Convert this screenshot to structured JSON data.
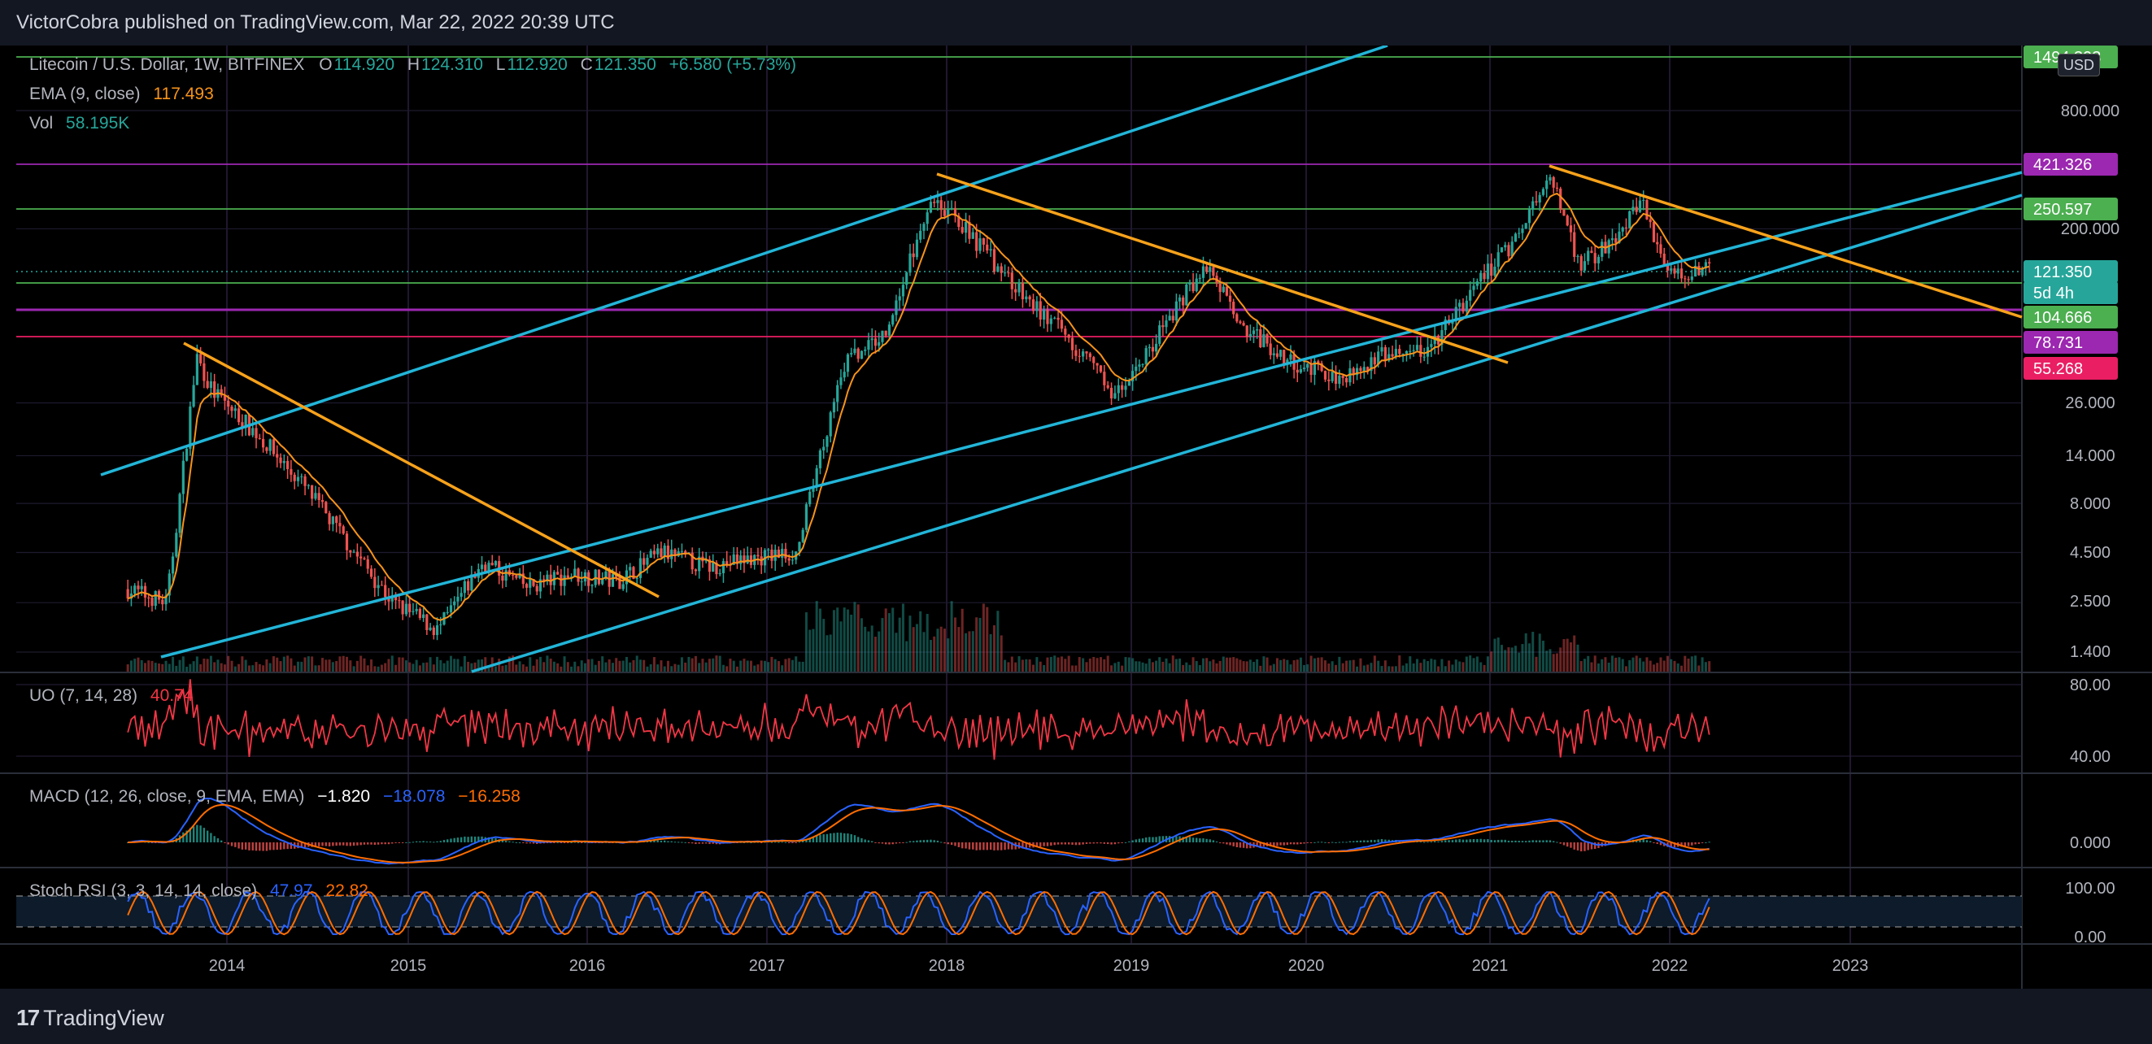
{
  "header": {
    "published": "VictorCobra published on TradingView.com, Mar 22, 2022 20:39 UTC"
  },
  "footer": {
    "logo_text": "TradingView",
    "logo_icon": "tradingview-logo-icon"
  },
  "legend": {
    "symbol": "Litecoin / U.S. Dollar, 1W, BITFINEX",
    "o_label": "O",
    "o": "114.920",
    "h_label": "H",
    "h": "124.310",
    "l_label": "L",
    "l": "112.920",
    "c_label": "C",
    "c": "121.350",
    "change": "+6.580 (+5.73%)",
    "ema_label": "EMA (9, close)",
    "ema": "117.493",
    "vol_label": "Vol",
    "vol": "58.195K",
    "currency": "USD"
  },
  "colors": {
    "background": "#000000",
    "up": "#26a69a",
    "down": "#ef5350",
    "channel": "#22b5d8",
    "trendline": "#f7a21b",
    "ema": "#f7931a",
    "uo": "#f23645",
    "macd": "#2962ff",
    "signal": "#ff6d00",
    "stoch_k": "#2962ff",
    "stoch_d": "#ff6d00",
    "level_green": "#4caf50",
    "level_purple": "#9c27b0",
    "level_pink": "#e91e63"
  },
  "price_axis": {
    "ticks": [
      "800.000",
      "200.000",
      "26.000",
      "14.000",
      "8.000",
      "4.500",
      "2.500",
      "1.400"
    ],
    "tags": [
      {
        "text": "1494.393",
        "color": "#4caf50"
      },
      {
        "text": "421.326",
        "color": "#9c27b0"
      },
      {
        "text": "250.597",
        "color": "#4caf50"
      },
      {
        "text": "121.350",
        "color": "#26a69a"
      },
      {
        "text": "5d 4h",
        "color": "#26a69a"
      },
      {
        "text": "104.666",
        "color": "#4caf50"
      },
      {
        "text": "78.731",
        "color": "#9c27b0"
      },
      {
        "text": "55.268",
        "color": "#e91e63"
      }
    ]
  },
  "time_axis": [
    "2014",
    "2015",
    "2016",
    "2017",
    "2018",
    "2019",
    "2020",
    "2021",
    "2022",
    "2023"
  ],
  "panes": {
    "uo": {
      "label": "UO (7, 14, 28)",
      "value": "40.74",
      "ticks": [
        "80.00",
        "40.00"
      ]
    },
    "macd": {
      "label": "MACD (12, 26, close, 9, EMA, EMA)",
      "v1": "−1.820",
      "v2": "−18.078",
      "v3": "−16.258",
      "ticks": [
        "0.000"
      ]
    },
    "stoch": {
      "label": "Stoch RSI (3, 3, 14, 14, close)",
      "k": "47.97",
      "d": "22.82",
      "ticks": [
        "100.00",
        "0.00"
      ]
    }
  },
  "chart_data": {
    "type": "candlestick",
    "symbol": "Litecoin / U.S. Dollar",
    "timeframe": "1W",
    "exchange": "BITFINEX",
    "y_scale": "log",
    "x_range": [
      "2013",
      "2023"
    ],
    "horizontal_levels": [
      1494.393,
      421.326,
      250.597,
      104.666,
      78.731,
      55.268
    ],
    "last_close": 121.35,
    "series": [
      {
        "name": "Price close (approx.)",
        "points": [
          [
            "2013-06",
            3.0
          ],
          [
            "2013-09",
            2.5
          ],
          [
            "2013-11",
            45
          ],
          [
            "2013-12",
            30
          ],
          [
            "2014-03",
            18
          ],
          [
            "2014-06",
            10
          ],
          [
            "2014-09",
            5
          ],
          [
            "2014-12",
            2.5
          ],
          [
            "2015-03",
            1.8
          ],
          [
            "2015-06",
            4.0
          ],
          [
            "2015-09",
            3.0
          ],
          [
            "2015-12",
            3.5
          ],
          [
            "2016-03",
            3.2
          ],
          [
            "2016-06",
            4.5
          ],
          [
            "2016-09",
            3.8
          ],
          [
            "2016-12",
            4.2
          ],
          [
            "2017-03",
            4.5
          ],
          [
            "2017-06",
            40
          ],
          [
            "2017-09",
            60
          ],
          [
            "2017-12",
            300
          ],
          [
            "2018-03",
            170
          ],
          [
            "2018-06",
            90
          ],
          [
            "2018-09",
            55
          ],
          [
            "2018-12",
            28
          ],
          [
            "2019-03",
            60
          ],
          [
            "2019-06",
            130
          ],
          [
            "2019-09",
            60
          ],
          [
            "2019-12",
            42
          ],
          [
            "2020-03",
            35
          ],
          [
            "2020-06",
            45
          ],
          [
            "2020-09",
            48
          ],
          [
            "2020-12",
            100
          ],
          [
            "2021-03",
            190
          ],
          [
            "2021-05",
            380
          ],
          [
            "2021-07",
            130
          ],
          [
            "2021-09",
            170
          ],
          [
            "2021-11",
            280
          ],
          [
            "2022-01",
            120
          ],
          [
            "2022-03",
            121.35
          ]
        ]
      }
    ]
  }
}
